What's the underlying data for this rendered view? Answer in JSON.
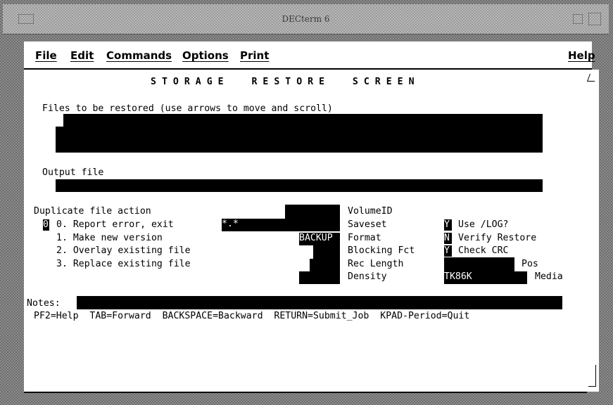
{
  "window": {
    "title": "DECterm 6"
  },
  "menu": {
    "file": "File",
    "edit": "Edit",
    "commands": "Commands",
    "options": "Options",
    "print": "Print",
    "help": "Help"
  },
  "screen": {
    "heading": "STORAGE  RESTORE  SCREEN",
    "files_label": "Files to be restored (use arrows to move and scroll)",
    "output_label": "Output file",
    "dup_label": "Duplicate file action",
    "dup_value": "0",
    "dup_options": [
      "0. Report error, exit",
      "1. Make new version",
      "2. Overlay existing file",
      "3. Replace existing file"
    ],
    "saveset_value": "*.*",
    "format_value": "BACKUP",
    "fields": {
      "volumeid": "VolumeID",
      "saveset": "Saveset",
      "format": "Format",
      "blocking": "Blocking Fct",
      "reclength": "Rec Length",
      "density": "Density"
    },
    "flags": {
      "log_value": "Y",
      "log_label": "Use /LOG?",
      "verify_value": "N",
      "verify_label": "Verify Restore",
      "crc_value": "Y",
      "crc_label": "Check CRC"
    },
    "pos_label": "Pos",
    "media_value": "TK86K",
    "media_label": "Media",
    "notes_label": "Notes:",
    "footer": "PF2=Help  TAB=Forward  BACKSPACE=Backward  RETURN=Submit_Job  KPAD-Period=Quit"
  }
}
